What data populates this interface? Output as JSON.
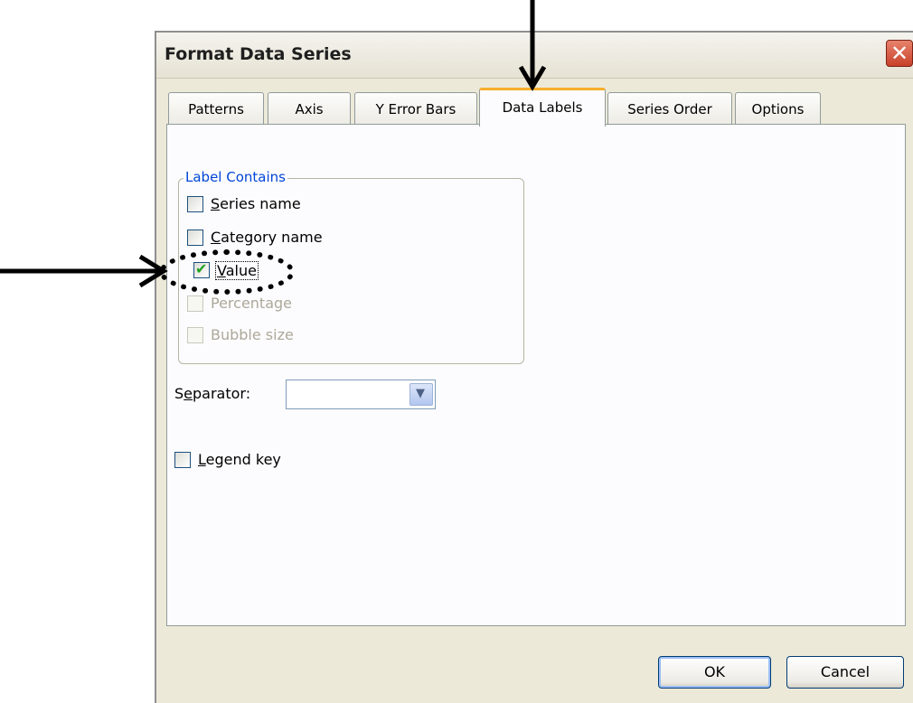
{
  "dialog": {
    "title": "Format Data Series",
    "close_glyph": "✕",
    "close_icon": "close-icon"
  },
  "tabs": [
    {
      "label": "Patterns",
      "active": false
    },
    {
      "label": "Axis",
      "active": false
    },
    {
      "label": "Y Error Bars",
      "active": false
    },
    {
      "label": "Data Labels",
      "active": true
    },
    {
      "label": "Series Order",
      "active": false
    },
    {
      "label": "Options",
      "active": false
    }
  ],
  "label_contains": {
    "group_title": "Label Contains",
    "options": [
      {
        "key": "S",
        "rest": "eries name",
        "checked": false,
        "enabled": true
      },
      {
        "key": "C",
        "rest": "ategory name",
        "checked": false,
        "enabled": true
      },
      {
        "key": "V",
        "rest": "alue",
        "checked": true,
        "enabled": true
      },
      {
        "key": "",
        "rest": "Percentage",
        "checked": false,
        "enabled": false
      },
      {
        "key": "",
        "rest": "Bubble size",
        "checked": false,
        "enabled": false
      }
    ]
  },
  "separator": {
    "label_pre": "S",
    "label_key": "e",
    "label_post": "parator:",
    "value": "",
    "arrow_icon": "chevron-down-icon"
  },
  "legend_key": {
    "key": "L",
    "rest": "egend key",
    "checked": false
  },
  "buttons": {
    "ok": "OK",
    "cancel": "Cancel"
  },
  "colors": {
    "active_tab_accent": "#f7ae2c",
    "group_title": "#0046d5",
    "close_button": "#c9412a"
  }
}
